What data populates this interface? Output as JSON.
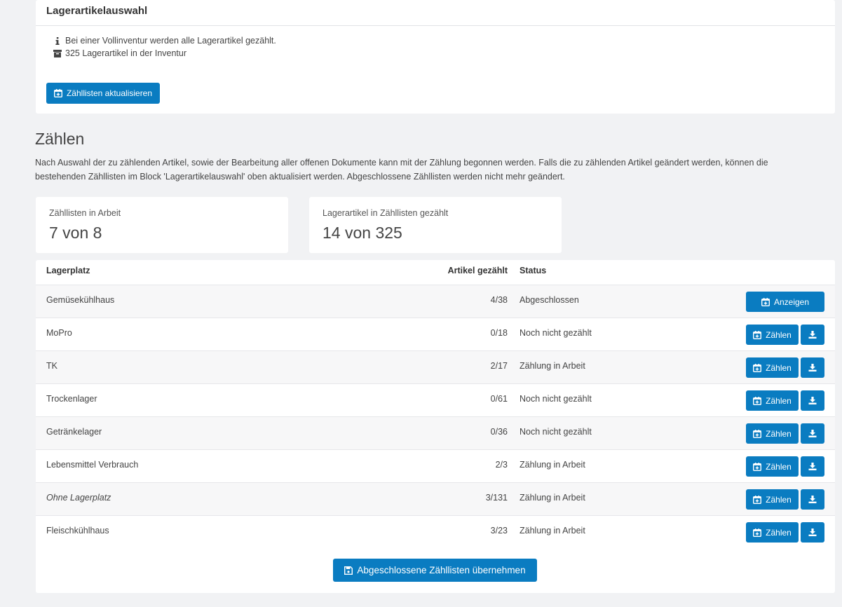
{
  "top_card": {
    "title": "Lagerartikelauswahl",
    "info_lines": [
      {
        "icon": "info-icon",
        "text": "Bei einer Vollinventur werden alle Lagerartikel gezählt."
      },
      {
        "icon": "archive-box-icon",
        "text": "325 Lagerartikel in der Inventur"
      }
    ],
    "update_button": "Zähllisten aktualisieren"
  },
  "counting": {
    "title": "Zählen",
    "description": "Nach Auswahl der zu zählenden Artikel, sowie der Bearbeitung aller offenen Dokumente kann mit der Zählung begonnen werden. Falls die zu zählenden Artikel geändert werden, können die bestehenden Zähllisten im Block 'Lagerartikelauswahl' oben aktualisiert werden. Abgeschlossene Zähllisten werden nicht mehr geändert."
  },
  "stats": [
    {
      "label": "Zähllisten in Arbeit",
      "value": "7 von 8"
    },
    {
      "label": "Lagerartikel in Zähllisten gezählt",
      "value": "14 von 325"
    }
  ],
  "table": {
    "headers": {
      "location": "Lagerplatz",
      "counted": "Artikel gezählt",
      "status": "Status"
    },
    "rows": [
      {
        "location": "Gemüsekühlhaus",
        "counted": "4/38",
        "status": "Abgeschlossen",
        "action": "Anzeigen",
        "italic": false,
        "download": false
      },
      {
        "location": "MoPro",
        "counted": "0/18",
        "status": "Noch nicht gezählt",
        "action": "Zählen",
        "italic": false,
        "download": true
      },
      {
        "location": "TK",
        "counted": "2/17",
        "status": "Zählung in Arbeit",
        "action": "Zählen",
        "italic": false,
        "download": true
      },
      {
        "location": "Trockenlager",
        "counted": "0/61",
        "status": "Noch nicht gezählt",
        "action": "Zählen",
        "italic": false,
        "download": true
      },
      {
        "location": "Getränkelager",
        "counted": "0/36",
        "status": "Noch nicht gezählt",
        "action": "Zählen",
        "italic": false,
        "download": true
      },
      {
        "location": "Lebensmittel Verbrauch",
        "counted": "2/3",
        "status": "Zählung in Arbeit",
        "action": "Zählen",
        "italic": false,
        "download": true
      },
      {
        "location": "Ohne Lagerplatz",
        "counted": "3/131",
        "status": "Zählung in Arbeit",
        "action": "Zählen",
        "italic": true,
        "download": true
      },
      {
        "location": "Fleischkühlhaus",
        "counted": "3/23",
        "status": "Zählung in Arbeit",
        "action": "Zählen",
        "italic": false,
        "download": true
      }
    ],
    "submit_button": "Abgeschlossene Zähllisten übernehmen"
  },
  "colors": {
    "accent": "#0a7cc1",
    "background": "#f1f2f4"
  }
}
